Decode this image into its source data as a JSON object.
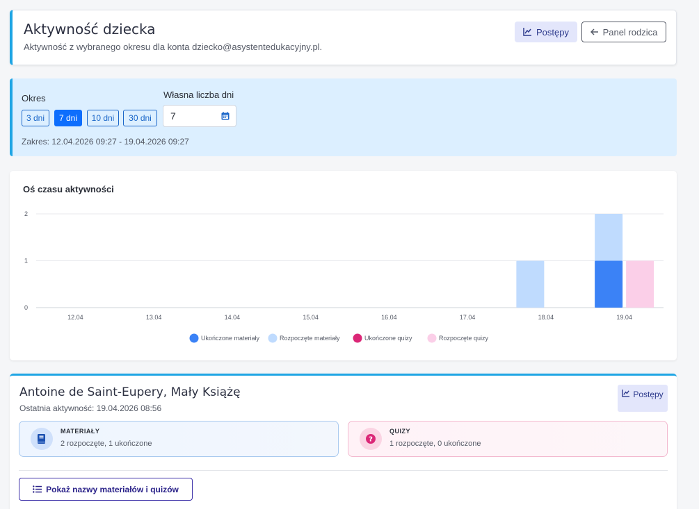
{
  "header": {
    "title": "Aktywność dziecka",
    "subtitle": "Aktywność z wybranego okresu dla konta dziecko@asystentedukacyjny.pl.",
    "progress_label": "Postępy",
    "parent_panel_label": "Panel rodzica"
  },
  "filter": {
    "period_label": "Okres",
    "periods": [
      "3 dni",
      "7 dni",
      "10 dni",
      "30 dni"
    ],
    "active_period": "7 dni",
    "custom_days_label": "Własna liczba dni",
    "custom_days_value": "7",
    "range_text": "Zakres: 12.04.2026 09:27 - 19.04.2026 09:27"
  },
  "chart": {
    "title": "Oś czasu aktywności"
  },
  "chart_data": {
    "type": "bar",
    "categories": [
      "12.04",
      "13.04",
      "14.04",
      "15.04",
      "16.04",
      "17.04",
      "18.04",
      "19.04"
    ],
    "series": [
      {
        "name": "Ukończone materiały",
        "color": "#3b82f6",
        "stack": "materials",
        "values": [
          0,
          0,
          0,
          0,
          0,
          0,
          0,
          1
        ]
      },
      {
        "name": "Rozpoczęte materiały",
        "color": "#bfdbfe",
        "stack": "materials",
        "values": [
          0,
          0,
          0,
          0,
          0,
          0,
          1,
          1
        ]
      },
      {
        "name": "Ukończone quizy",
        "color": "#db2777",
        "stack": "quizzes",
        "values": [
          0,
          0,
          0,
          0,
          0,
          0,
          0,
          0
        ]
      },
      {
        "name": "Rozpoczęte quizy",
        "color": "#fbcfe8",
        "stack": "quizzes",
        "values": [
          0,
          0,
          0,
          0,
          0,
          0,
          0,
          1
        ]
      }
    ],
    "yticks": [
      0,
      1,
      2
    ],
    "ylim": [
      0,
      2
    ],
    "grid": true,
    "legend": "bottom"
  },
  "book": {
    "title": "Antoine de Saint-Eupery, Mały Książę",
    "last_activity": "Ostatnia aktywność: 19.04.2026 08:56",
    "progress_label": "Postępy",
    "materials": {
      "heading": "MATERIAŁY",
      "value": "2 rozpoczęte, 1 ukończone",
      "icon": "book-icon"
    },
    "quizzes": {
      "heading": "QUIZY",
      "value": "1 rozpoczęte, 0 ukończone",
      "icon": "question-icon"
    },
    "show_names_label": "Pokaż nazwy materiałów i quizów"
  }
}
